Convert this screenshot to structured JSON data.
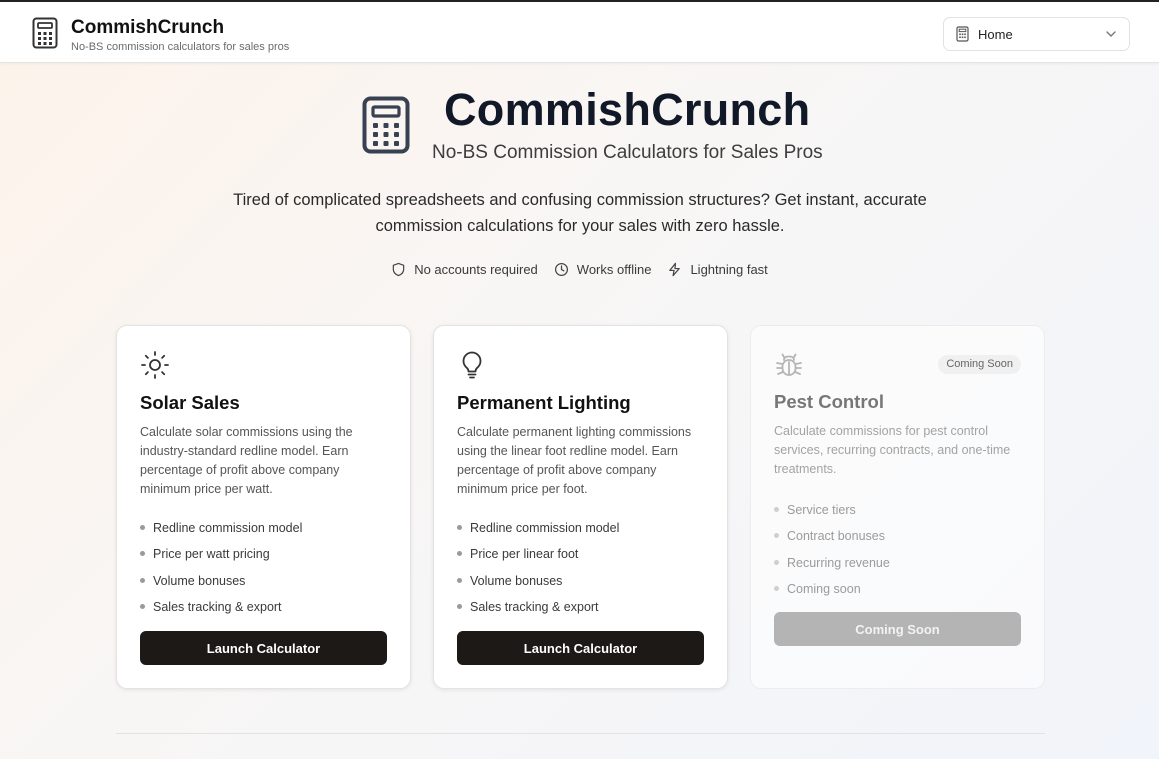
{
  "header": {
    "brand_title": "CommishCrunch",
    "brand_subtitle": "No-BS commission calculators for sales pros",
    "nav_select": {
      "selected": "Home"
    }
  },
  "hero": {
    "title": "CommishCrunch",
    "subtitle": "No-BS Commission Calculators for Sales Pros",
    "description": "Tired of complicated spreadsheets and confusing commission structures? Get instant, accurate commission calculations for your sales with zero hassle.",
    "features": [
      {
        "icon": "shield-icon",
        "label": "No accounts required"
      },
      {
        "icon": "clock-icon",
        "label": "Works offline"
      },
      {
        "icon": "lightning-icon",
        "label": "Lightning fast"
      }
    ]
  },
  "cards": [
    {
      "icon": "sun-icon",
      "title": "Solar Sales",
      "description": "Calculate solar commissions using the industry-standard redline model. Earn percentage of profit above company minimum price per watt.",
      "features": [
        "Redline commission model",
        "Price per watt pricing",
        "Volume bonuses",
        "Sales tracking & export"
      ],
      "button": "Launch Calculator"
    },
    {
      "icon": "lightbulb-icon",
      "title": "Permanent Lighting",
      "description": "Calculate permanent lighting commissions using the linear foot redline model. Earn percentage of profit above company minimum price per foot.",
      "features": [
        "Redline commission model",
        "Price per linear foot",
        "Volume bonuses",
        "Sales tracking & export"
      ],
      "button": "Launch Calculator"
    },
    {
      "icon": "bug-icon",
      "title": "Pest Control",
      "badge": "Coming Soon",
      "description": "Calculate commissions for pest control services, recurring contracts, and one-time treatments.",
      "features": [
        "Service tiers",
        "Contract bonuses",
        "Recurring revenue",
        "Coming soon"
      ],
      "button": "Coming Soon"
    }
  ],
  "colors": {
    "primary_button": "#1c1917",
    "disabled_button": "#b4b4b4",
    "heading": "#111827"
  }
}
